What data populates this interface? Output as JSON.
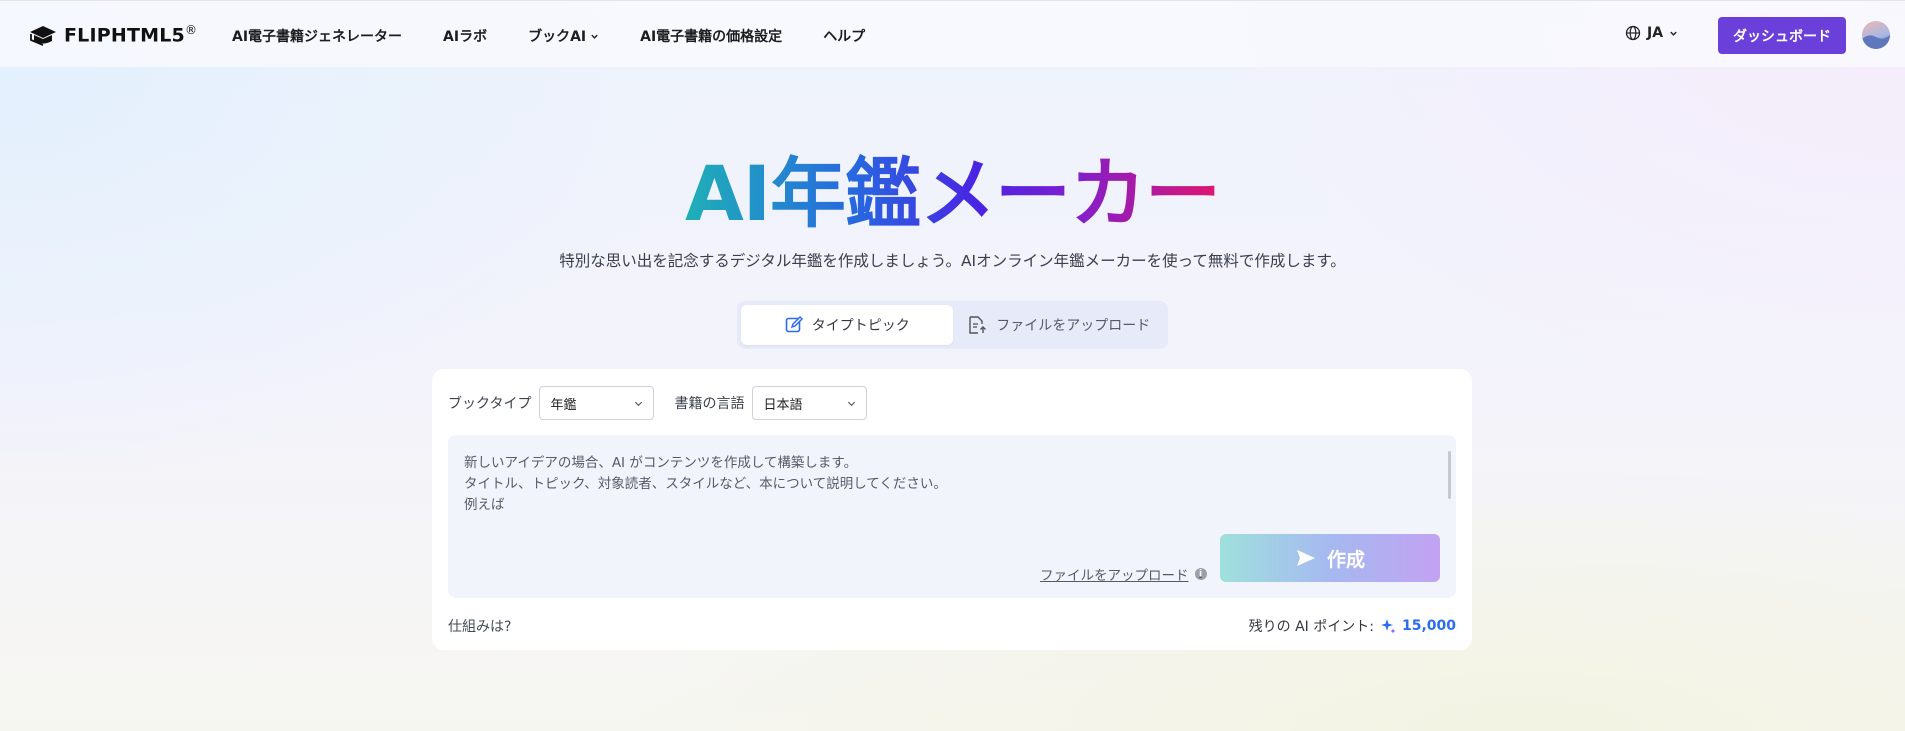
{
  "header": {
    "logo_text": "FLIPHTML5",
    "logo_mark": "®",
    "nav": [
      {
        "label": "AI電子書籍ジェネレーター",
        "has_dropdown": false
      },
      {
        "label": "AIラボ",
        "has_dropdown": false
      },
      {
        "label": "ブックAI",
        "has_dropdown": true
      },
      {
        "label": "AI電子書籍の価格設定",
        "has_dropdown": false
      },
      {
        "label": "ヘルプ",
        "has_dropdown": false
      }
    ],
    "language": "JA",
    "dashboard_label": "ダッシュボード",
    "accent_color": "#6b3fd9"
  },
  "hero": {
    "title": "AI年鑑メーカー",
    "subtitle": "特別な思い出を記念するデジタル年鑑を作成しましょう。AIオンライン年鑑メーカーを使って無料で作成します。"
  },
  "tabs": [
    {
      "label": "タイプトピック",
      "icon": "edit-icon",
      "active": true
    },
    {
      "label": "ファイルをアップロード",
      "icon": "file-upload-icon",
      "active": false
    }
  ],
  "form": {
    "book_type_label": "ブックタイプ",
    "book_type_value": "年鑑",
    "language_label": "書籍の言語",
    "language_value": "日本語",
    "prompt_lines": [
      "新しいアイデアの場合、AI がコンテンツを作成して構築します。",
      "タイトル、トピック、対象読者、スタイルなど、本について説明してください。",
      "例えば"
    ],
    "upload_link": "ファイルをアップロード",
    "create_label": "作成",
    "how_label": "仕組みは?",
    "points_label": "残りの AI ポイント:",
    "points_value": "15,000"
  }
}
